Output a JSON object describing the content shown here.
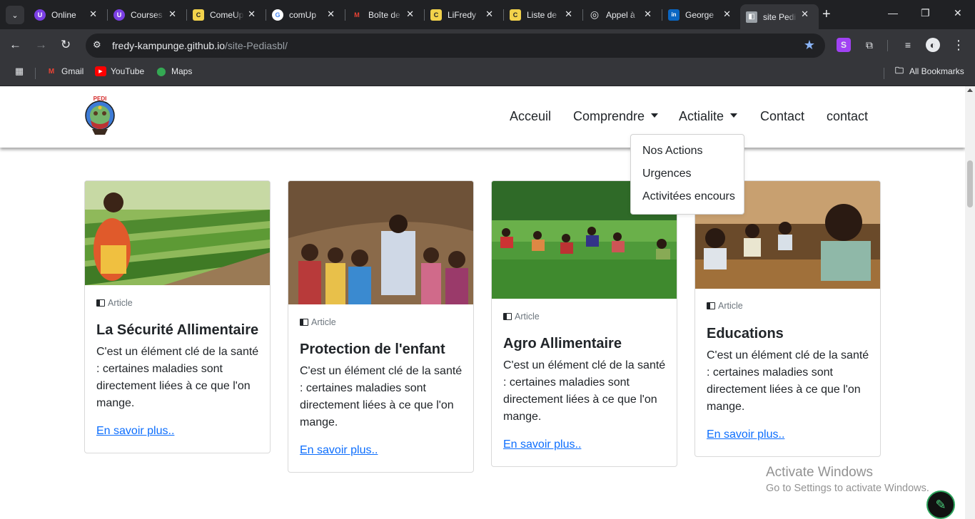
{
  "browser": {
    "tabs": [
      {
        "label": "Online",
        "fav_color": "#7b3fe4",
        "fav_glyph": "U"
      },
      {
        "label": "Courses",
        "fav_color": "#7b3fe4",
        "fav_glyph": "U"
      },
      {
        "label": "ComeUp",
        "fav_color": "#f2d24b",
        "fav_glyph": "C"
      },
      {
        "label": "comUp",
        "fav_color": "#ffffff",
        "fav_glyph": "G"
      },
      {
        "label": "Boîte de",
        "fav_color": "#202124",
        "fav_glyph": "M"
      },
      {
        "label": "LiFredy",
        "fav_color": "#f2d24b",
        "fav_glyph": "C"
      },
      {
        "label": "Liste de",
        "fav_color": "#f2d24b",
        "fav_glyph": "C"
      },
      {
        "label": "Appel à",
        "fav_color": "#202124",
        "fav_glyph": "◎"
      },
      {
        "label": "George",
        "fav_color": "#0a66c2",
        "fav_glyph": "in"
      },
      {
        "label": "site Pedi",
        "fav_color": "#9aa0a6",
        "fav_glyph": "◧"
      }
    ],
    "url_host": "fredy-kampunge.github.io",
    "url_path": "/site-Pediasbl/",
    "bookmarks": [
      {
        "label": "Gmail",
        "icon": "gmail-icon"
      },
      {
        "label": "YouTube",
        "icon": "youtube-icon"
      },
      {
        "label": "Maps",
        "icon": "maps-icon"
      }
    ],
    "all_bookmarks": "All Bookmarks"
  },
  "site": {
    "logo_text": "PEDI",
    "nav": {
      "accueil": "Acceuil",
      "comprendre": "Comprendre",
      "actialite": "Actialite",
      "contact1": "Contact",
      "contact2": "contact"
    },
    "dropdown": [
      "Nos Actions",
      "Urgences",
      "Activitées encours"
    ],
    "cards": [
      {
        "badge": "Article",
        "title": "La Sécurité Allimentaire",
        "text": "C'est un élément clé de la santé : certaines maladies sont directement liées à ce que l'on mange.",
        "link": "En savoir plus.."
      },
      {
        "badge": "Article",
        "title": "Protection de l'enfant",
        "text": "C'est un élément clé de la santé : certaines maladies sont directement liées à ce que l'on mange.",
        "link": "En savoir plus.."
      },
      {
        "badge": "Article",
        "title": "Agro Allimentaire",
        "text": "C'est un élément clé de la santé : certaines maladies sont directement liées à ce que l'on mange.",
        "link": "En savoir plus.."
      },
      {
        "badge": "Article",
        "title": "Educations",
        "text": "C'est un élément clé de la santé : certaines maladies sont directement liées à ce que l'on mange.",
        "link": "En savoir plus.."
      }
    ]
  },
  "os": {
    "watermark_title": "Activate Windows",
    "watermark_sub": "Go to Settings to activate Windows."
  },
  "colors": {
    "link": "#0d6efd",
    "chrome_dark": "#202124",
    "chrome_toolbar": "#35363a"
  }
}
